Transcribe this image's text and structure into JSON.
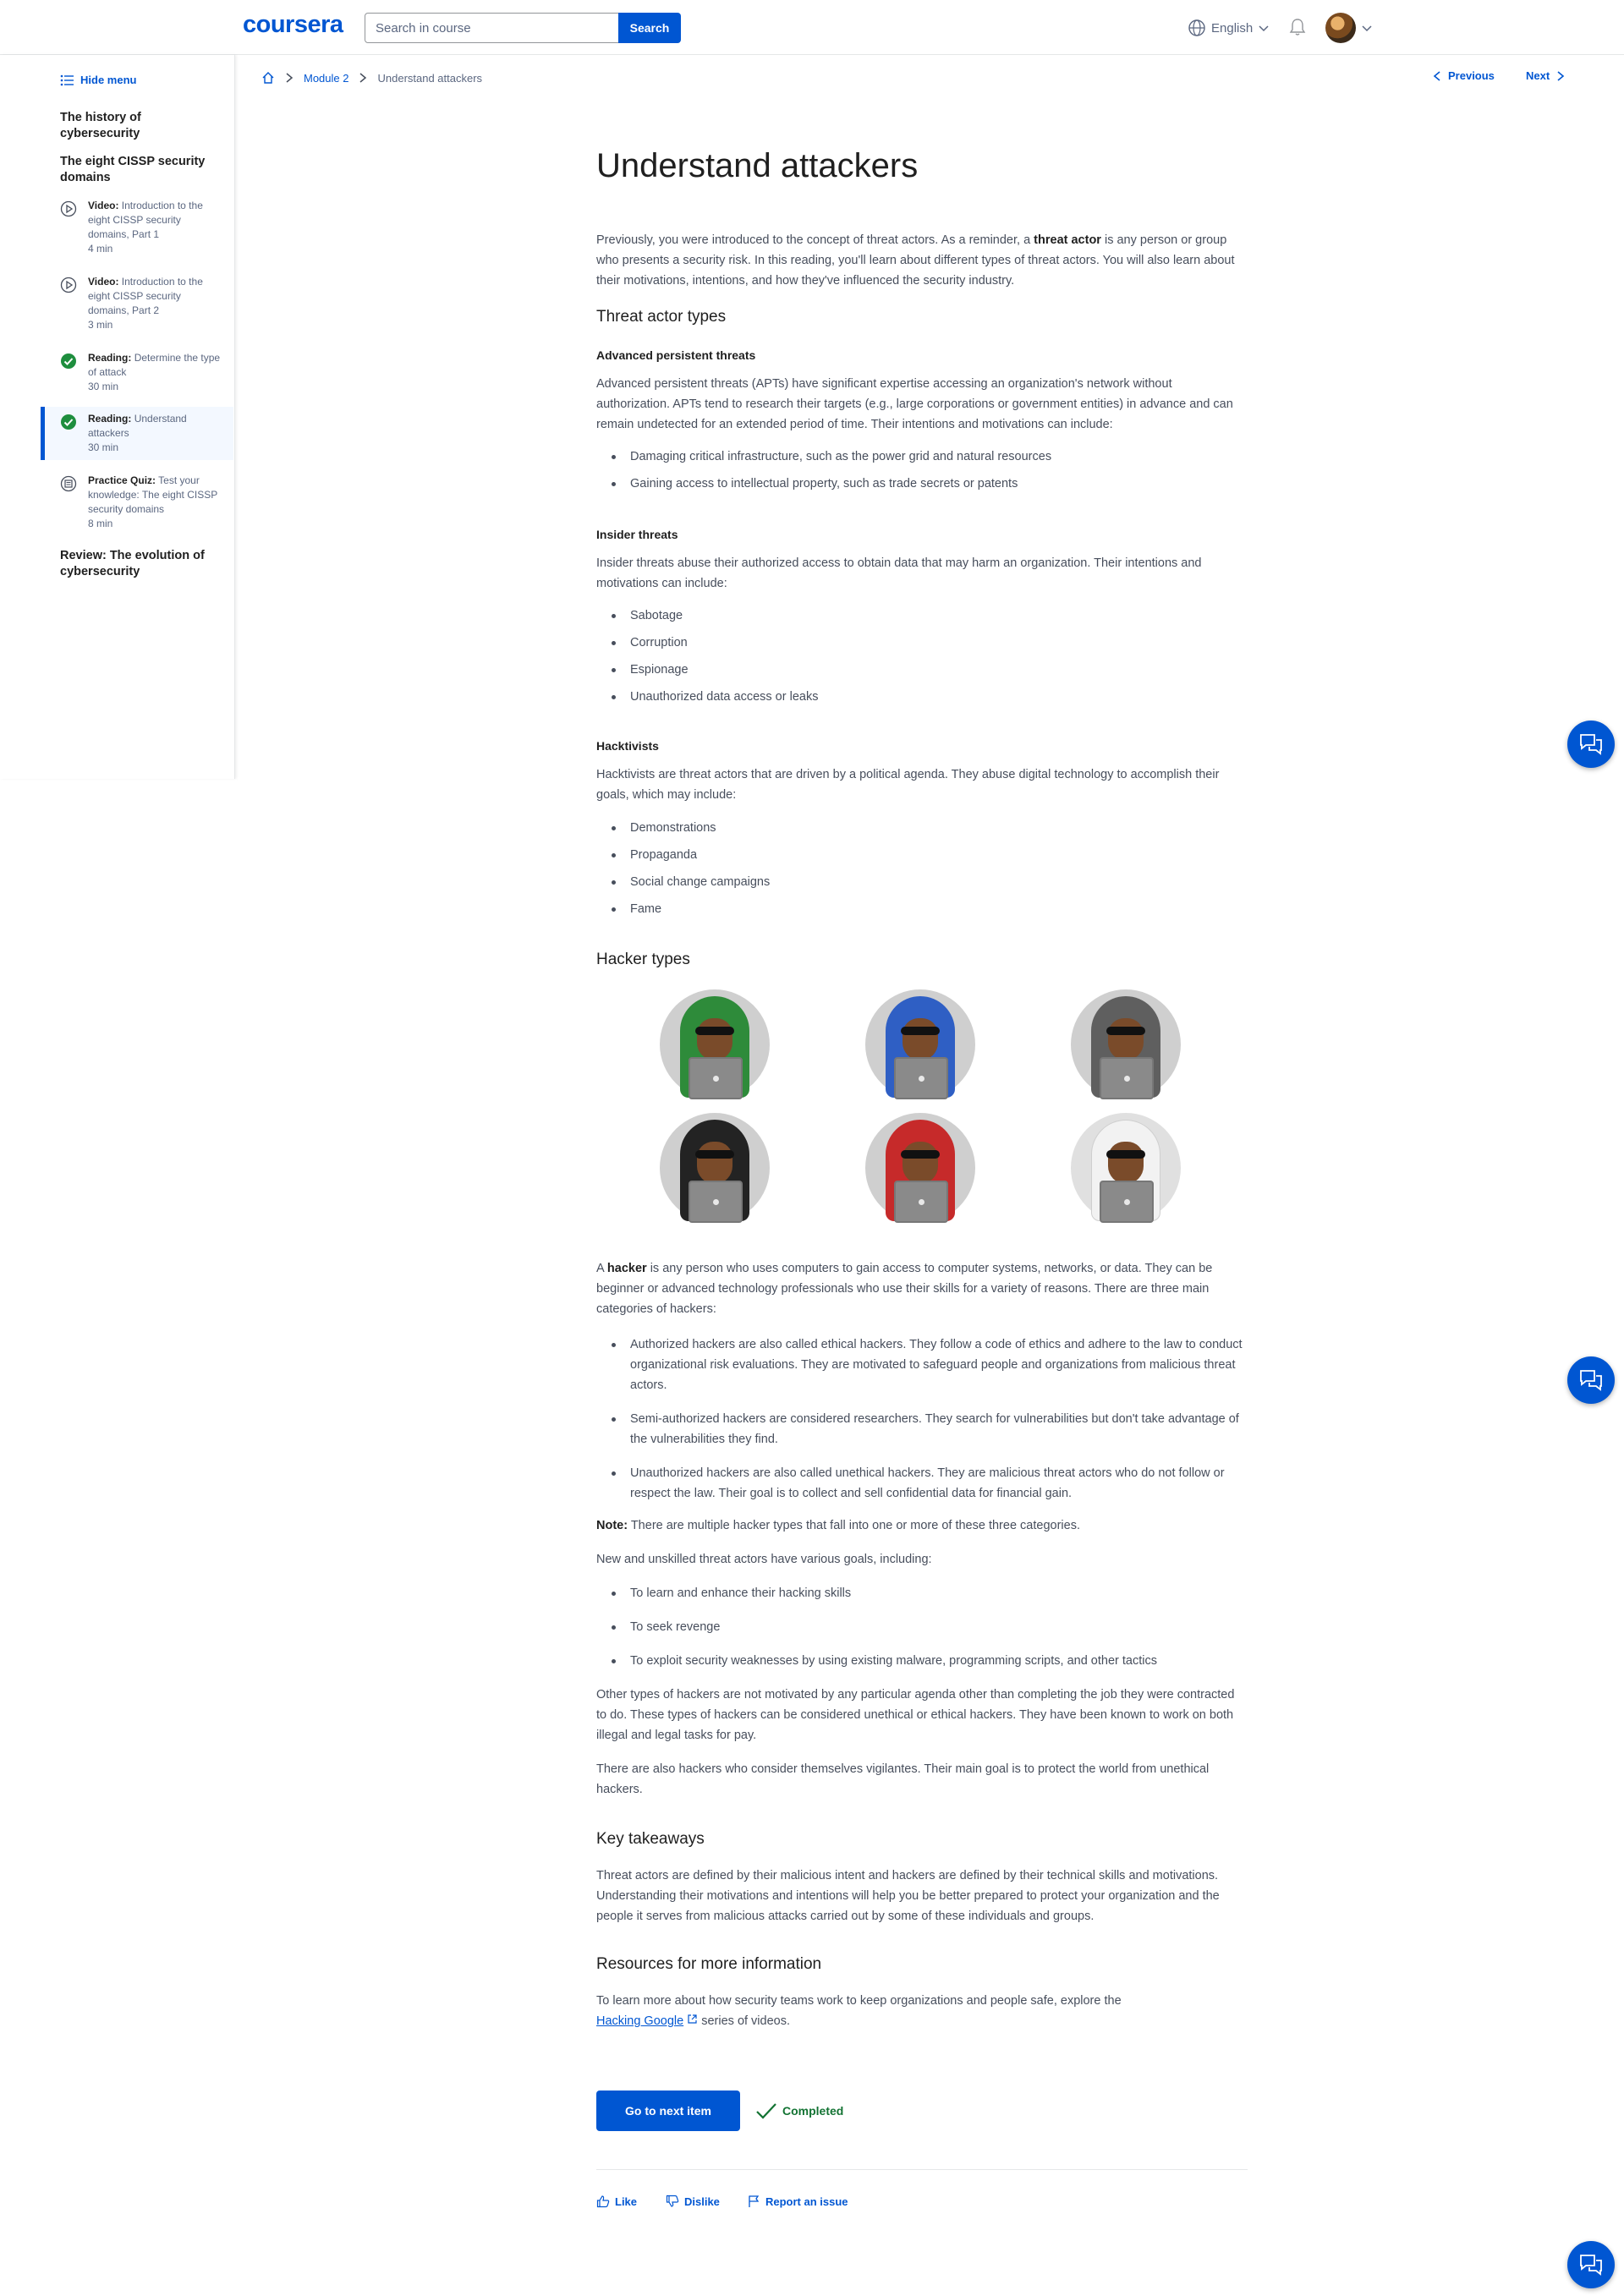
{
  "header": {
    "logo": "coursera",
    "search_placeholder": "Search in course",
    "search_button": "Search",
    "language": "English"
  },
  "sidebar": {
    "hide_menu": "Hide menu",
    "section1": "The history of cybersecurity",
    "section2": "The eight CISSP security domains",
    "items": [
      {
        "type": "Video:",
        "title": "Introduction to the eight CISSP security domains, Part 1",
        "duration": "4 min",
        "icon": "play-icon"
      },
      {
        "type": "Video:",
        "title": "Introduction to the eight CISSP security domains, Part 2",
        "duration": "3 min",
        "icon": "play-icon"
      },
      {
        "type": "Reading:",
        "title": "Determine the type of attack",
        "duration": "30 min",
        "icon": "check-icon"
      },
      {
        "type": "Reading:",
        "title": "Understand attackers",
        "duration": "30 min",
        "icon": "check-icon"
      },
      {
        "type": "Practice Quiz:",
        "title": "Test your knowledge: The eight CISSP security domains",
        "duration": "8 min",
        "icon": "quiz-icon"
      }
    ],
    "section3": "Review: The evolution of cybersecurity"
  },
  "breadcrumb": {
    "module": "Module 2",
    "current": "Understand attackers"
  },
  "nav": {
    "previous": "Previous",
    "next": "Next"
  },
  "article": {
    "title": "Understand attackers",
    "intro_a": "Previously, you were introduced to the concept of threat actors. As a reminder, a ",
    "intro_bold": "threat actor",
    "intro_b": " is any person or group who presents a security risk. In this reading, you'll learn about different types of threat actors. You will also learn about their motivations, intentions, and how they've influenced the security industry.",
    "h_threat_types": "Threat actor types",
    "h_apt": "Advanced persistent threats",
    "apt_text": "Advanced persistent threats (APTs) have significant expertise accessing an organization's network without authorization. APTs tend to research their targets (e.g., large corporations or government entities)  in advance and can remain undetected for an extended period of time. Their intentions and motivations can include:",
    "apt_list": [
      "Damaging critical infrastructure, such as the power grid and natural resources",
      "Gaining access to intellectual property, such as trade secrets or patents"
    ],
    "h_insider": "Insider threats",
    "insider_text": "Insider threats abuse their authorized access to obtain data that may harm an organization. Their intentions and motivations can include:",
    "insider_list": [
      "Sabotage",
      "Corruption",
      "Espionage",
      "Unauthorized data access or leaks"
    ],
    "h_hacktivists": "Hacktivists",
    "hacktivists_text": "Hacktivists are threat actors that are driven by a political agenda. They abuse digital technology to accomplish their goals, which may include:",
    "hacktivists_list": [
      "Demonstrations",
      "Propaganda",
      "Social change campaigns",
      "Fame"
    ],
    "h_hacker_types": "Hacker types",
    "hacker_colors": [
      "#2e8b3a",
      "#2f5fc4",
      "#5f5f5f",
      "#232323",
      "#c62a2a",
      "#f2f2f2"
    ],
    "hacker_a": "A ",
    "hacker_bold": "hacker",
    "hacker_b": " is any person who uses computers to gain access to computer systems, networks, or data. They can be beginner or advanced technology professionals who use their skills for a variety of reasons. There are three main categories of hackers:",
    "hacker_list": [
      "Authorized hackers are also called ethical hackers. They follow a code of ethics and adhere to the law to conduct organizational risk evaluations. They are motivated to safeguard people and organizations from malicious threat actors.",
      "Semi-authorized hackers are considered researchers. They search for vulnerabilities but don't take advantage of the vulnerabilities they find.",
      "Unauthorized hackers are also called unethical hackers. They are malicious threat actors who do not follow or respect the law. Their goal is to collect and sell confidential data for financial gain."
    ],
    "note_label": "Note:",
    "note_text": " There are multiple hacker types that fall into one or more of these three categories.",
    "new_text": "New and unskilled threat actors have various goals, including:",
    "new_list": [
      "To learn and enhance their hacking skills",
      "To seek revenge",
      "To exploit security weaknesses by using existing malware, programming scripts, and other tactics"
    ],
    "other_text": "Other types of hackers are not motivated by any particular agenda other than completing the job they were contracted to do. These types of hackers can be considered unethical or ethical hackers. They have been known to work on both illegal and legal tasks for pay.",
    "vigilante_text": "There are also hackers who consider themselves vigilantes. Their main goal is to protect the world from unethical hackers.",
    "h_takeaways": "Key takeaways",
    "takeaways_text": "Threat actors are defined by their malicious intent and hackers are defined by their technical skills and motivations. Understanding their motivations and intentions will help you be better prepared to protect your organization and the people it serves from malicious attacks carried out by some of these individuals and groups.",
    "h_resources": "Resources for more information",
    "resources_a": "To learn more about how security teams work to keep organizations and people safe, explore the",
    "resources_link": "Hacking Google",
    "resources_b": " series of videos."
  },
  "footer": {
    "next_button": "Go to next item",
    "completed": "Completed",
    "like": "Like",
    "dislike": "Dislike",
    "report": "Report an issue"
  },
  "colors": {
    "primary": "#0056d2",
    "success": "#137333"
  }
}
